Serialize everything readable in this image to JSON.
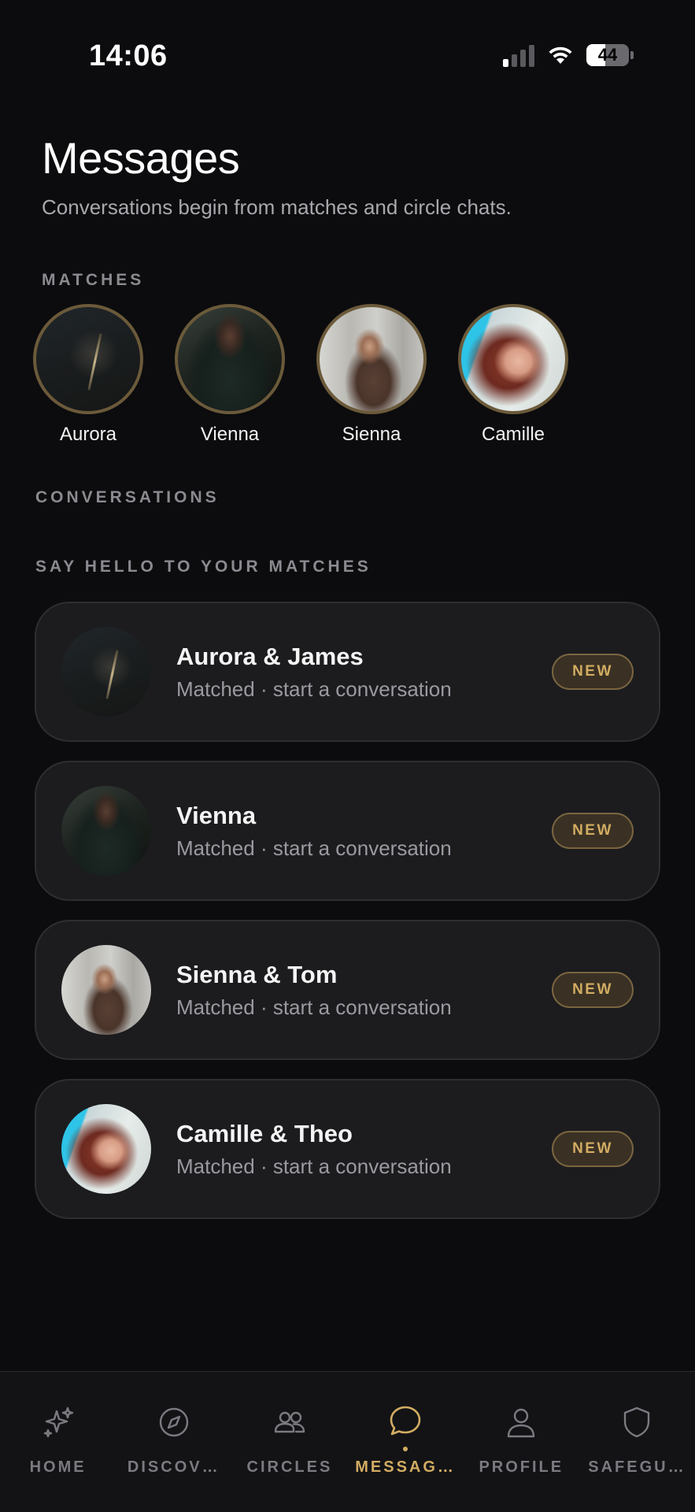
{
  "status_bar": {
    "time": "14:06",
    "battery": "44",
    "battery_level": 0.44
  },
  "header": {
    "title": "Messages",
    "subtitle": "Conversations begin from matches and circle chats."
  },
  "sections": {
    "matches_label": "MATCHES",
    "conversations_label": "CONVERSATIONS",
    "say_hello_label": "SAY HELLO TO YOUR MATCHES"
  },
  "matches": [
    {
      "name": "Aurora"
    },
    {
      "name": "Vienna"
    },
    {
      "name": "Sienna"
    },
    {
      "name": "Camille"
    }
  ],
  "conversations": [
    {
      "name": "Aurora & James",
      "subtitle": "Matched · start a conversation",
      "badge": "NEW"
    },
    {
      "name": "Vienna",
      "subtitle": "Matched · start a conversation",
      "badge": "NEW"
    },
    {
      "name": "Sienna & Tom",
      "subtitle": "Matched · start a conversation",
      "badge": "NEW"
    },
    {
      "name": "Camille & Theo",
      "subtitle": "Matched · start a conversation",
      "badge": "NEW"
    }
  ],
  "bottom_nav": {
    "items": [
      {
        "label": "HOME",
        "icon": "sparkles-icon"
      },
      {
        "label": "DISCOV…",
        "icon": "compass-icon"
      },
      {
        "label": "CIRCLES",
        "icon": "people-icon"
      },
      {
        "label": "MESSAG…",
        "icon": "chat-bubble-icon",
        "active": true
      },
      {
        "label": "PROFILE",
        "icon": "person-icon"
      },
      {
        "label": "SAFEGU…",
        "icon": "shield-icon"
      }
    ]
  },
  "colors": {
    "background": "#0c0c0e",
    "card": "#1c1c1f",
    "accent_gold": "#d2ac62",
    "muted_text": "#9a9aa0"
  }
}
